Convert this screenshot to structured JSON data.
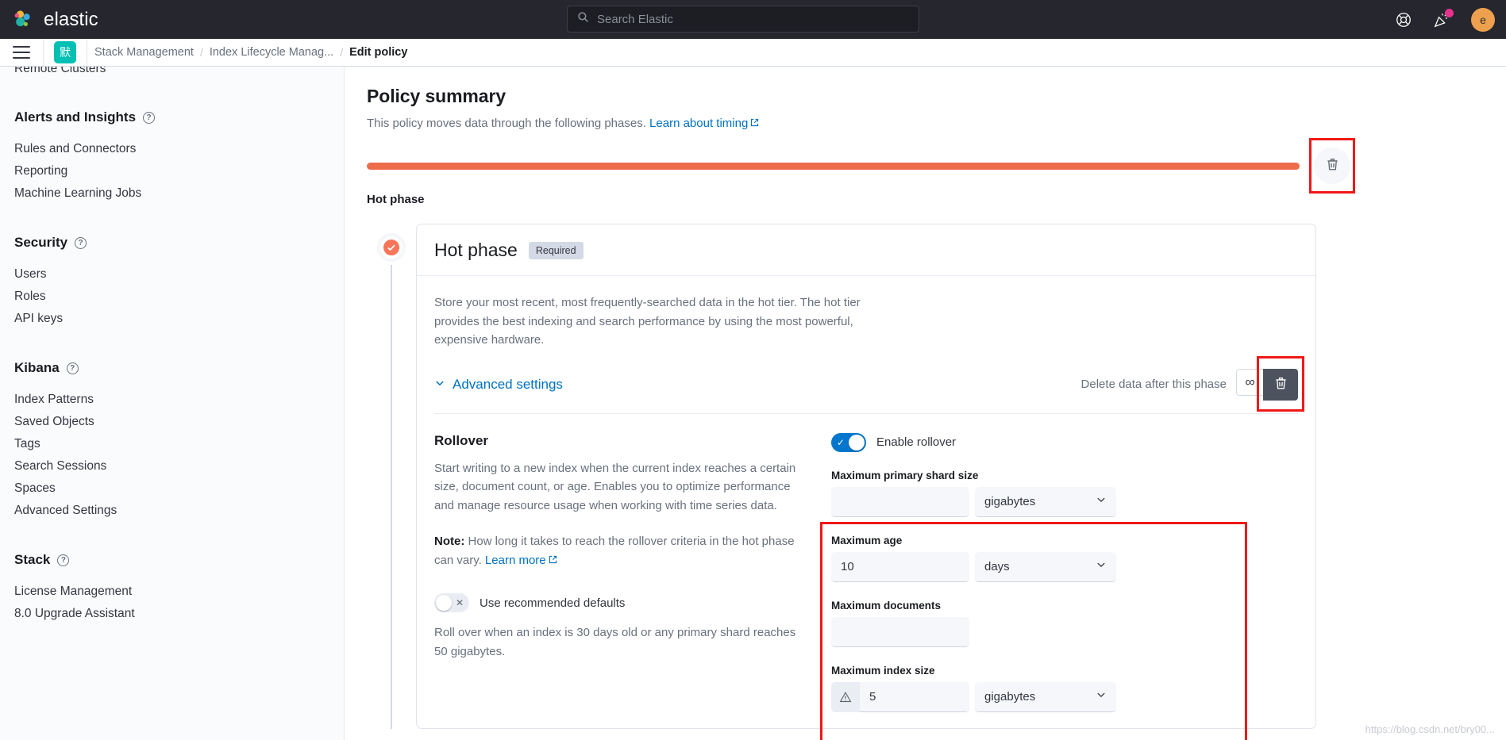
{
  "header": {
    "brand": "elastic",
    "logo_icon": "elastic-logo-icon",
    "search": {
      "placeholder": "Search Elastic",
      "value": "",
      "icon": "search-icon"
    },
    "help_icon": "help-lifering-icon",
    "news_icon": "news-announcement-icon",
    "avatar_initial": "e"
  },
  "breadcrumb": {
    "menu_icon": "hamburger-menu-icon",
    "space_badge": "默",
    "items": [
      {
        "label": "Stack Management",
        "active": false
      },
      {
        "label": "Index Lifecycle Manag...",
        "active": false
      },
      {
        "label": "Edit policy",
        "active": true
      }
    ],
    "separator": "/"
  },
  "sidebar": {
    "clipped_item": "Remote Clusters",
    "groups": [
      {
        "title": "Alerts and Insights",
        "help_icon": "question-circle-icon",
        "items": [
          "Rules and Connectors",
          "Reporting",
          "Machine Learning Jobs"
        ]
      },
      {
        "title": "Security",
        "help_icon": "question-circle-icon",
        "items": [
          "Users",
          "Roles",
          "API keys"
        ]
      },
      {
        "title": "Kibana",
        "help_icon": "question-circle-icon",
        "items": [
          "Index Patterns",
          "Saved Objects",
          "Tags",
          "Search Sessions",
          "Spaces",
          "Advanced Settings"
        ]
      },
      {
        "title": "Stack",
        "help_icon": "question-circle-icon",
        "items": [
          "License Management",
          "8.0 Upgrade Assistant"
        ]
      }
    ]
  },
  "main": {
    "page_title": "Policy summary",
    "page_subtitle": "This policy moves data through the following phases.",
    "timing_link": "Learn about timing",
    "timeline": {
      "bar_color": "#ee6c4c",
      "phase_label": "Hot phase",
      "trash_icon": "trash-icon"
    },
    "phase": {
      "status_icon": "check-circle-icon",
      "title": "Hot phase",
      "badge": "Required",
      "description": "Store your most recent, most frequently-searched data in the hot tier. The hot tier provides the best indexing and search performance by using the most powerful, expensive hardware.",
      "advanced_settings_label": "Advanced settings",
      "advanced_settings_icon": "chevron-down-icon",
      "delete_label": "Delete data after this phase",
      "infinity_icon": "infinity-icon",
      "delete_trash_icon": "trash-icon"
    },
    "rollover": {
      "title": "Rollover",
      "description": "Start writing to a new index when the current index reaches a certain size, document count, or age. Enables you to optimize performance and manage resource usage when working with time series data.",
      "note_prefix": "Note:",
      "note_text": " How long it takes to reach the rollover criteria in the hot phase can vary. ",
      "note_link": "Learn more",
      "defaults_toggle": {
        "label": "Use recommended defaults",
        "state": "off",
        "mark": "✕"
      },
      "defaults_desc": "Roll over when an index is 30 days old or any primary shard reaches 50 gigabytes.",
      "enable_toggle": {
        "label": "Enable rollover",
        "state": "on",
        "mark": "✓"
      },
      "fields": [
        {
          "label": "Maximum primary shard size",
          "value": "",
          "unit": "gigabytes",
          "warn": false
        },
        {
          "label": "Maximum age",
          "value": "10",
          "unit": "days",
          "warn": false
        },
        {
          "label": "Maximum documents",
          "value": "",
          "unit": null,
          "warn": false
        },
        {
          "label": "Maximum index size",
          "value": "5",
          "unit": "gigabytes",
          "warn": true
        }
      ],
      "warn_icon": "warning-triangle-icon",
      "select_icon": "chevron-down-icon"
    },
    "watermark": "https://blog.csdn.net/bry00..."
  },
  "colors": {
    "accent_hot": "#ee6c4c",
    "link": "#0071c2",
    "toggle_on": "#0077cc",
    "annotation": "#f01818",
    "space_badge": "#00bfb3"
  }
}
